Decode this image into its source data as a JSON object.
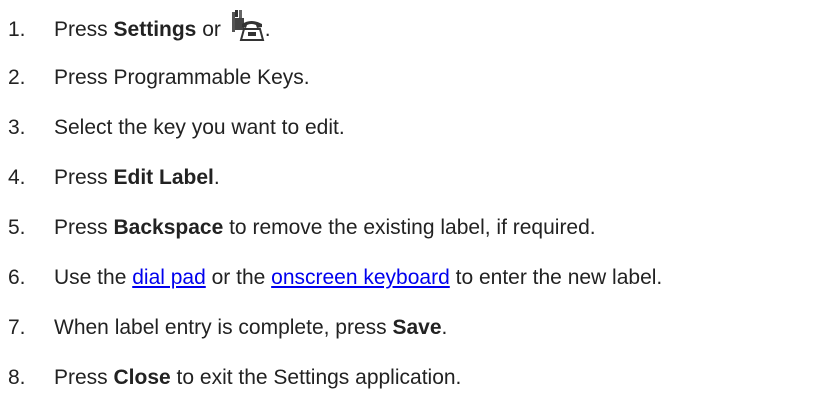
{
  "steps": [
    {
      "number": "1.",
      "text_before": "Press ",
      "bold": "Settings",
      "text_middle": " or ",
      "icon": "settings-phone-icon",
      "text_after": "."
    },
    {
      "number": "2.",
      "text": "Press Programmable Keys."
    },
    {
      "number": "3.",
      "text": "Select the key you want to edit."
    },
    {
      "number": "4.",
      "text_before": "Press ",
      "bold": "Edit Label",
      "text_after": "."
    },
    {
      "number": "5.",
      "text_before": "Press ",
      "bold": "Backspace",
      "text_after": " to remove the existing label, if required."
    },
    {
      "number": "6.",
      "text_before": "Use the ",
      "link1": "dial pad",
      "text_middle": " or the ",
      "link2": "onscreen keyboard",
      "text_after": " to enter the new label."
    },
    {
      "number": "7.",
      "text_before": "When label entry is complete, press ",
      "bold": "Save",
      "text_after": "."
    },
    {
      "number": "8.",
      "text_before": "Press ",
      "bold": "Close",
      "text_after": " to exit the Settings application."
    }
  ],
  "colors": {
    "text": "#222222",
    "link": "#0000ee"
  }
}
